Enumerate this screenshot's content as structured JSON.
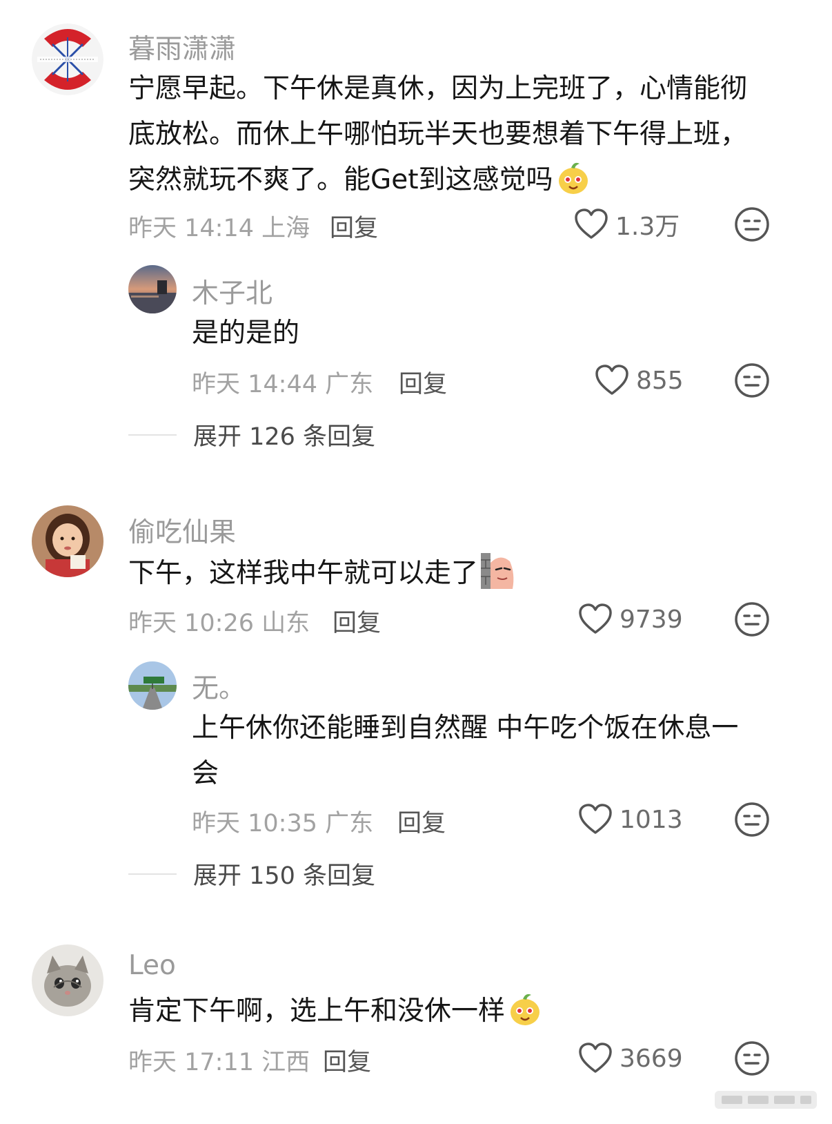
{
  "comments": [
    {
      "username": "暮雨潇潇",
      "text": "宁愿早起。下午休是真休，因为上完班了，心情能彻底放松。而休上午哪怕玩半天也要想着下午得上班，突然就玩不爽了。能Get到这感觉吗",
      "text_lines": [
        "宁愿早起。下午休是真休，因为上完班了，心情能彻",
        "底放松。而休上午哪怕玩半天也要想着下午得上班，",
        "突然就玩不爽了。能Get到这感觉吗"
      ],
      "emoji": "smiling-mango-emoji",
      "time": "昨天 14:14",
      "location": "上海",
      "reply_label": "回复",
      "likes": "1.3万",
      "replies": [
        {
          "username": "木子北",
          "text_lines": [
            "是的是的"
          ],
          "time": "昨天 14:44",
          "location": "广东",
          "reply_label": "回复",
          "likes": "855"
        }
      ],
      "expand_label": "展开 126 条回复"
    },
    {
      "username": "偷吃仙果",
      "text_lines": [
        "下午，这样我中午就可以走了"
      ],
      "emoji": "peeking-wall-emoji",
      "time": "昨天 10:26",
      "location": "山东",
      "reply_label": "回复",
      "likes": "9739",
      "replies": [
        {
          "username": "无。",
          "text_lines": [
            "上午休你还能睡到自然醒 中午吃个饭在休息一",
            "会"
          ],
          "time": "昨天 10:35",
          "location": "广东",
          "reply_label": "回复",
          "likes": "1013"
        }
      ],
      "expand_label": "展开 150 条回复"
    },
    {
      "username": "Leo",
      "text_lines": [
        "肯定下午啊，选上午和没休一样"
      ],
      "emoji": "smiling-mango-emoji",
      "time": "昨天 17:11",
      "location": "江西",
      "reply_label": "回复",
      "likes": "3669"
    }
  ],
  "icons": {
    "like": "heart-outline-icon",
    "dislike": "meh-face-icon"
  },
  "colors": {
    "username": "#9a9a9a",
    "meta": "#a2a2a2",
    "text": "#161616"
  }
}
